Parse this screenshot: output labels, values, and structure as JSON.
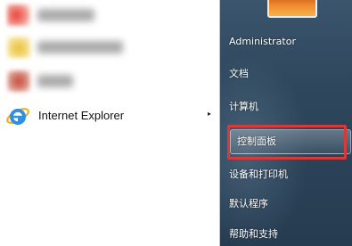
{
  "left_pane": {
    "pinned_programs": [
      {
        "label": "",
        "icon": "blurred-program-icon"
      },
      {
        "label": "",
        "icon": "blurred-program-icon"
      },
      {
        "label": "",
        "icon": "blurred-program-icon"
      }
    ],
    "ie_item": {
      "label": "Internet Explorer",
      "icon": "internet-explorer-icon",
      "arrow": "▸"
    }
  },
  "right_pane": {
    "items": [
      {
        "label": "Administrator"
      },
      {
        "label": "文档"
      },
      {
        "label": "计算机"
      },
      {
        "label": "控制面板",
        "highlighted": true
      },
      {
        "label": "设备和打印机"
      },
      {
        "label": "默认程序"
      },
      {
        "label": "帮助和支持"
      }
    ],
    "highlight_color": "#d63a3a"
  }
}
